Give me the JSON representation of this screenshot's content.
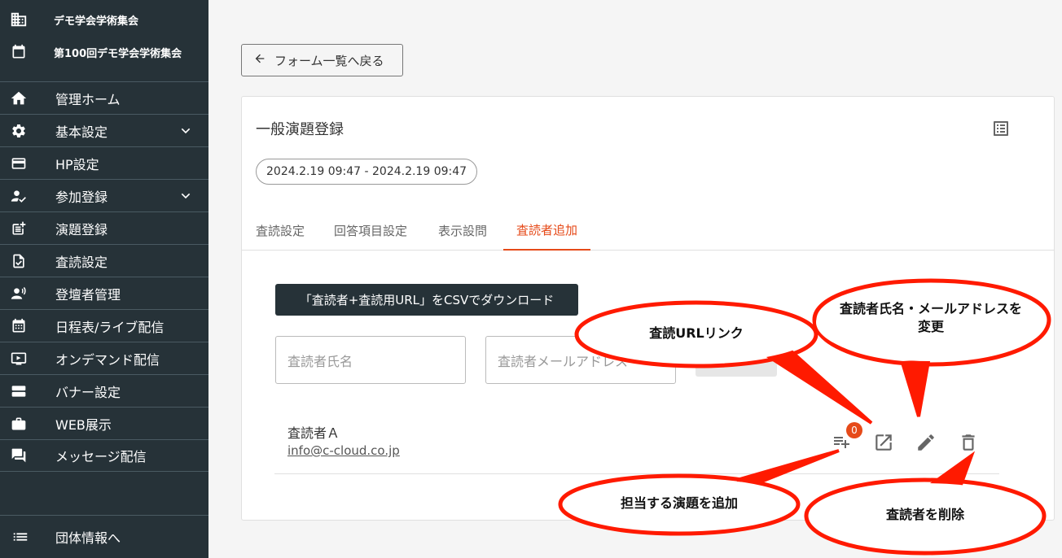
{
  "sidebar": {
    "org_name": "デモ学会学術集会",
    "event_name": "第100回デモ学会学術集会",
    "items": [
      {
        "label": "管理ホーム",
        "icon": "home-icon"
      },
      {
        "label": "基本設定",
        "icon": "gear-icon",
        "expandable": true
      },
      {
        "label": "HP設定",
        "icon": "web-icon"
      },
      {
        "label": "参加登録",
        "icon": "person-check-icon",
        "expandable": true
      },
      {
        "label": "演題登録",
        "icon": "post-add-icon"
      },
      {
        "label": "査読設定",
        "icon": "doc-check-icon"
      },
      {
        "label": "登壇者管理",
        "icon": "speaker-icon"
      },
      {
        "label": "日程表/ライブ配信",
        "icon": "calendar-icon"
      },
      {
        "label": "オンデマンド配信",
        "icon": "video-icon"
      },
      {
        "label": "バナー設定",
        "icon": "banner-icon"
      },
      {
        "label": "WEB展示",
        "icon": "briefcase-icon"
      },
      {
        "label": "メッセージ配信",
        "icon": "chat-icon"
      }
    ],
    "footer_label": "団体情報へ"
  },
  "back_button": "フォーム一覧へ戻る",
  "form": {
    "title": "一般演題登録",
    "period": "2024.2.19 09:47 - 2024.2.19 09:47",
    "tabs": [
      "査読設定",
      "回答項目設定",
      "表示設問",
      "査読者追加"
    ],
    "active_tab": 3
  },
  "csv_button": "「査読者+査読用URL」をCSVでダウンロード",
  "name_placeholder": "査読者氏名",
  "email_placeholder": "査読者メールアドレス",
  "reviewer": {
    "name": "査読者Ａ",
    "email": "info@c-cloud.co.jp",
    "assigned_count": "0"
  },
  "callouts": {
    "url_link": "査読URLリンク",
    "edit": "査読者氏名・メールアドレスを変更",
    "add_topic": "担当する演題を追加",
    "delete": "査読者を削除"
  },
  "colors": {
    "sidebar_bg": "#263238",
    "accent": "#e64a19",
    "callout_red": "#ff1a00"
  }
}
